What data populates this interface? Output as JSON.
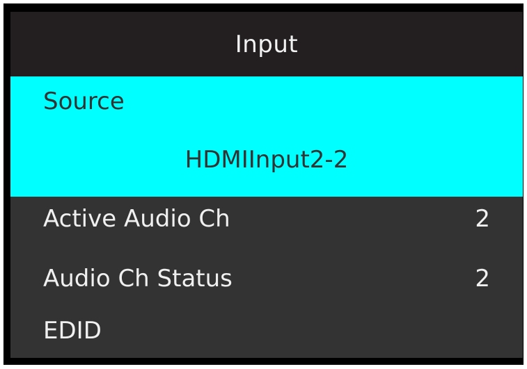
{
  "menu": {
    "title": "Input",
    "source": {
      "label": "Source",
      "value": "HDMIInput2-2"
    },
    "items": [
      {
        "label": "Active Audio Ch",
        "value": "2"
      },
      {
        "label": "Audio Ch Status",
        "value": "2"
      },
      {
        "label": "EDID",
        "value": ""
      }
    ]
  },
  "colors": {
    "title_bar": "#231f20",
    "highlight": "#00ffff",
    "menu_background": "#333333",
    "text_light": "#f0f0f0",
    "text_dark": "#333333"
  }
}
